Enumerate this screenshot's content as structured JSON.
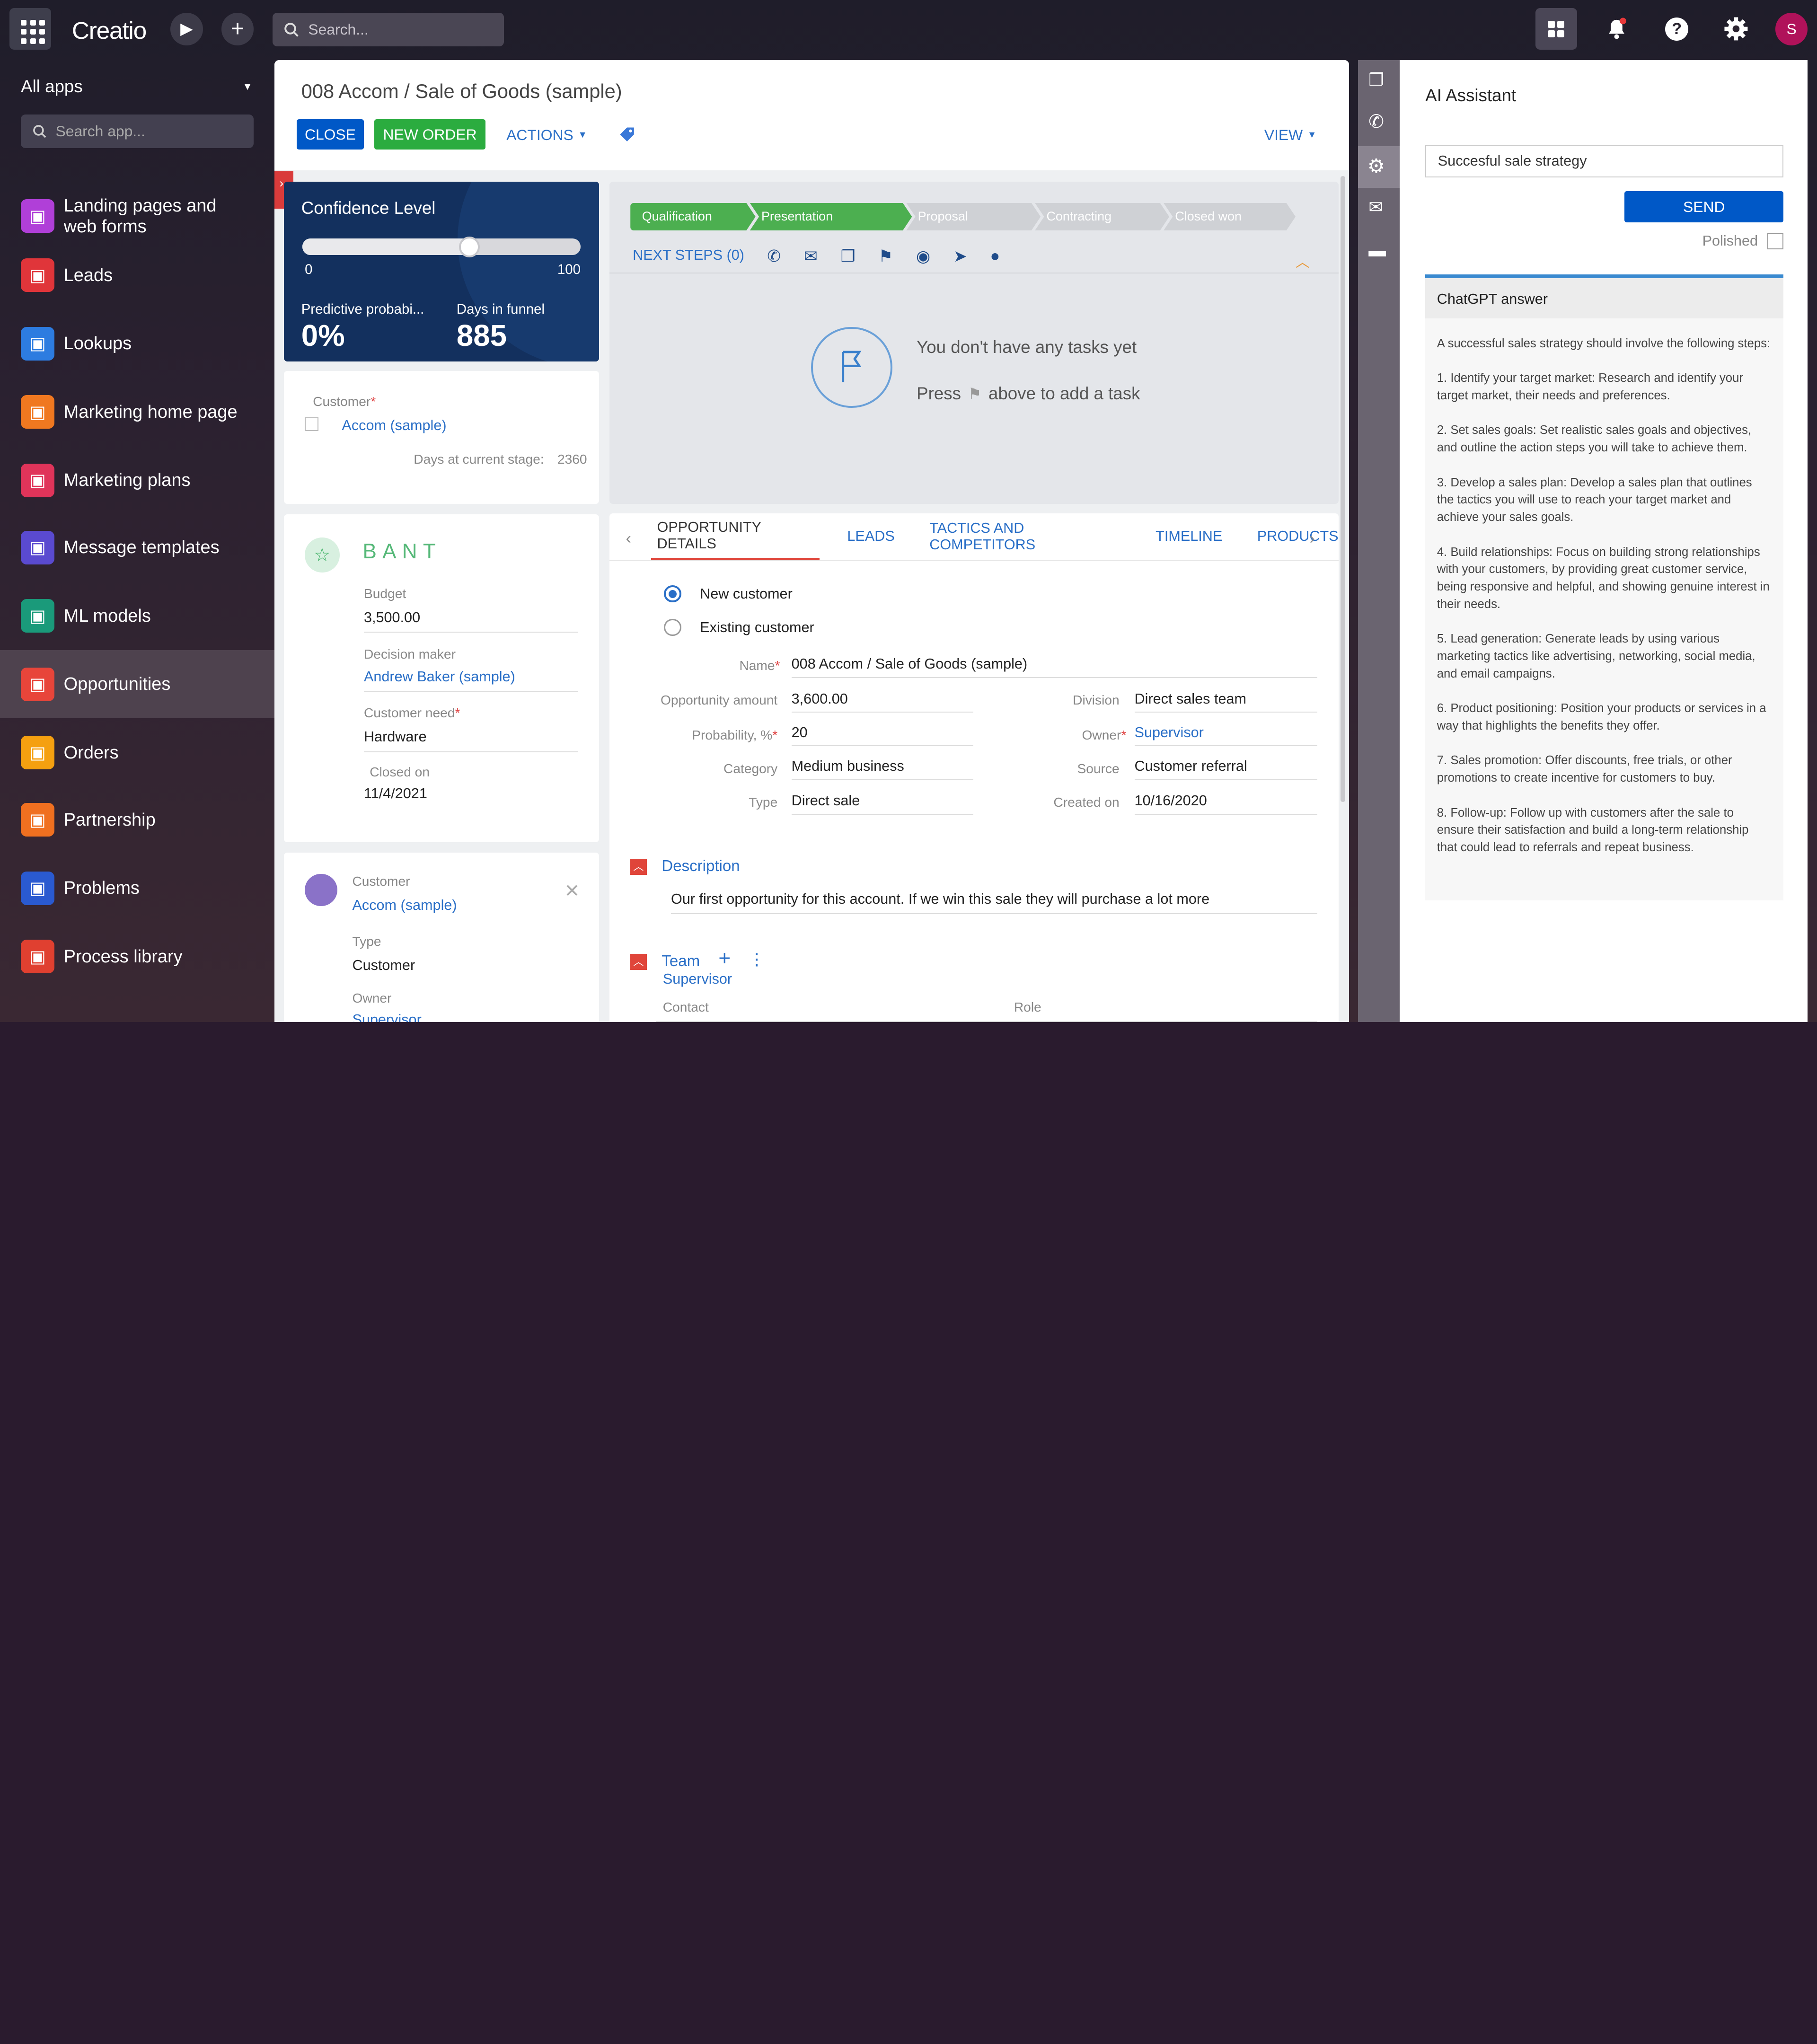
{
  "topbar": {
    "logo": "Creatio",
    "search_placeholder": "Search...",
    "avatar": "S"
  },
  "sidebar": {
    "title": "All apps",
    "search_placeholder": "Search app...",
    "items": [
      {
        "label": "Landing pages and web forms",
        "color": "#b03fd8",
        "icon": "landing-icon"
      },
      {
        "label": "Leads",
        "color": "#e0353a",
        "icon": "leads-icon"
      },
      {
        "label": "Lookups",
        "color": "#2d7ce0",
        "icon": "lookups-icon"
      },
      {
        "label": "Marketing home page",
        "color": "#f07820",
        "icon": "home-icon"
      },
      {
        "label": "Marketing plans",
        "color": "#e0345a",
        "icon": "plans-icon"
      },
      {
        "label": "Message templates",
        "color": "#5a4ad0",
        "icon": "templates-icon"
      },
      {
        "label": "ML models",
        "color": "#1a9a7a",
        "icon": "ml-icon"
      },
      {
        "label": "Opportunities",
        "color": "#e8453a",
        "icon": "opportunities-icon"
      },
      {
        "label": "Orders",
        "color": "#f5a010",
        "icon": "orders-icon"
      },
      {
        "label": "Partnership",
        "color": "#f07020",
        "icon": "partnership-icon"
      },
      {
        "label": "Problems",
        "color": "#2a5ad0",
        "icon": "problems-icon"
      },
      {
        "label": "Process library",
        "color": "#e04030",
        "icon": "process-icon"
      }
    ]
  },
  "page": {
    "title": "008 Accom / Sale of Goods (sample)",
    "close": "CLOSE",
    "new_order": "NEW ORDER",
    "actions": "ACTIONS",
    "view": "VIEW"
  },
  "confidence": {
    "title": "Confidence Level",
    "min": "0",
    "max": "100",
    "level": 0.6,
    "pred_label": "Predictive probabi...",
    "pred_value": "0%",
    "days_label": "Days in funnel",
    "days_value": "885"
  },
  "customer_card": {
    "label": "Customer",
    "value": "Accom (sample)",
    "days_stage_label": "Days at current stage:",
    "days_stage_value": "2360"
  },
  "bant": {
    "title": "BANT",
    "budget_label": "Budget",
    "budget": "3,500.00",
    "decision_label": "Decision maker",
    "decision": "Andrew Baker (sample)",
    "need_label": "Customer need",
    "need": "Hardware",
    "closed_label": "Closed on",
    "closed": "11/4/2021"
  },
  "contact_card": {
    "label": "Customer",
    "value": "Accom (sample)",
    "type_label": "Type",
    "type": "Customer",
    "owner_label": "Owner",
    "owner": "Supervisor"
  },
  "stages": [
    "Qualification",
    "Presentation",
    "Proposal",
    "Contracting",
    "Closed won"
  ],
  "next_steps": "NEXT STEPS (0)",
  "tasks": {
    "empty": "You don't have any tasks yet",
    "press": "Press",
    "add": "above to add a task"
  },
  "tabs": [
    "OPPORTUNITY DETAILS",
    "LEADS",
    "TACTICS AND COMPETITORS",
    "TIMELINE",
    "PRODUCTS"
  ],
  "details": {
    "new_customer": "New customer",
    "existing_customer": "Existing customer",
    "name_label": "Name",
    "name": "008 Accom / Sale of Goods (sample)",
    "amount_label": "Opportunity amount",
    "amount": "3,600.00",
    "prob_label": "Probability, %",
    "prob": "20",
    "category_label": "Category",
    "category": "Medium business",
    "type_label": "Type",
    "type": "Direct sale",
    "division_label": "Division",
    "division": "Direct sales team",
    "owner_label": "Owner",
    "owner": "Supervisor",
    "source_label": "Source",
    "source": "Customer referral",
    "created_label": "Created on",
    "created": "10/16/2020",
    "desc_title": "Description",
    "desc": "Our first opportunity for this account. If we win this sale they will purchase a lot more",
    "team_title": "Team",
    "contact_col": "Contact",
    "role_col": "Role",
    "team_contact": "Supervisor"
  },
  "ai": {
    "title": "AI Assistant",
    "input": "Succesful sale strategy",
    "send": "SEND",
    "polished": "Polished",
    "answer_title": "ChatGPT answer",
    "paragraphs": [
      "A successful sales strategy should involve the following steps:",
      "1. Identify your target market: Research and identify your target market, their needs and preferences.",
      "2. Set sales goals: Set realistic sales goals and objectives, and outline the action steps you will take to achieve them.",
      "3. Develop a sales plan: Develop a sales plan that outlines the tactics you will use to reach your target market and achieve your sales goals.",
      "4. Build relationships: Focus on building strong relationships with your customers, by providing great customer service, being responsive and helpful, and showing genuine interest in their needs.",
      "5. Lead generation: Generate leads by using various marketing tactics like advertising, networking, social media, and email campaigns.",
      "6. Product positioning: Position your products or services in a way that highlights the benefits they offer.",
      "7. Sales promotion: Offer discounts, free trials, or other promotions to create incentive for customers to buy.",
      "8. Follow-up: Follow up with customers after the sale to ensure their satisfaction and build a long-term relationship that could lead to referrals and repeat business."
    ]
  }
}
